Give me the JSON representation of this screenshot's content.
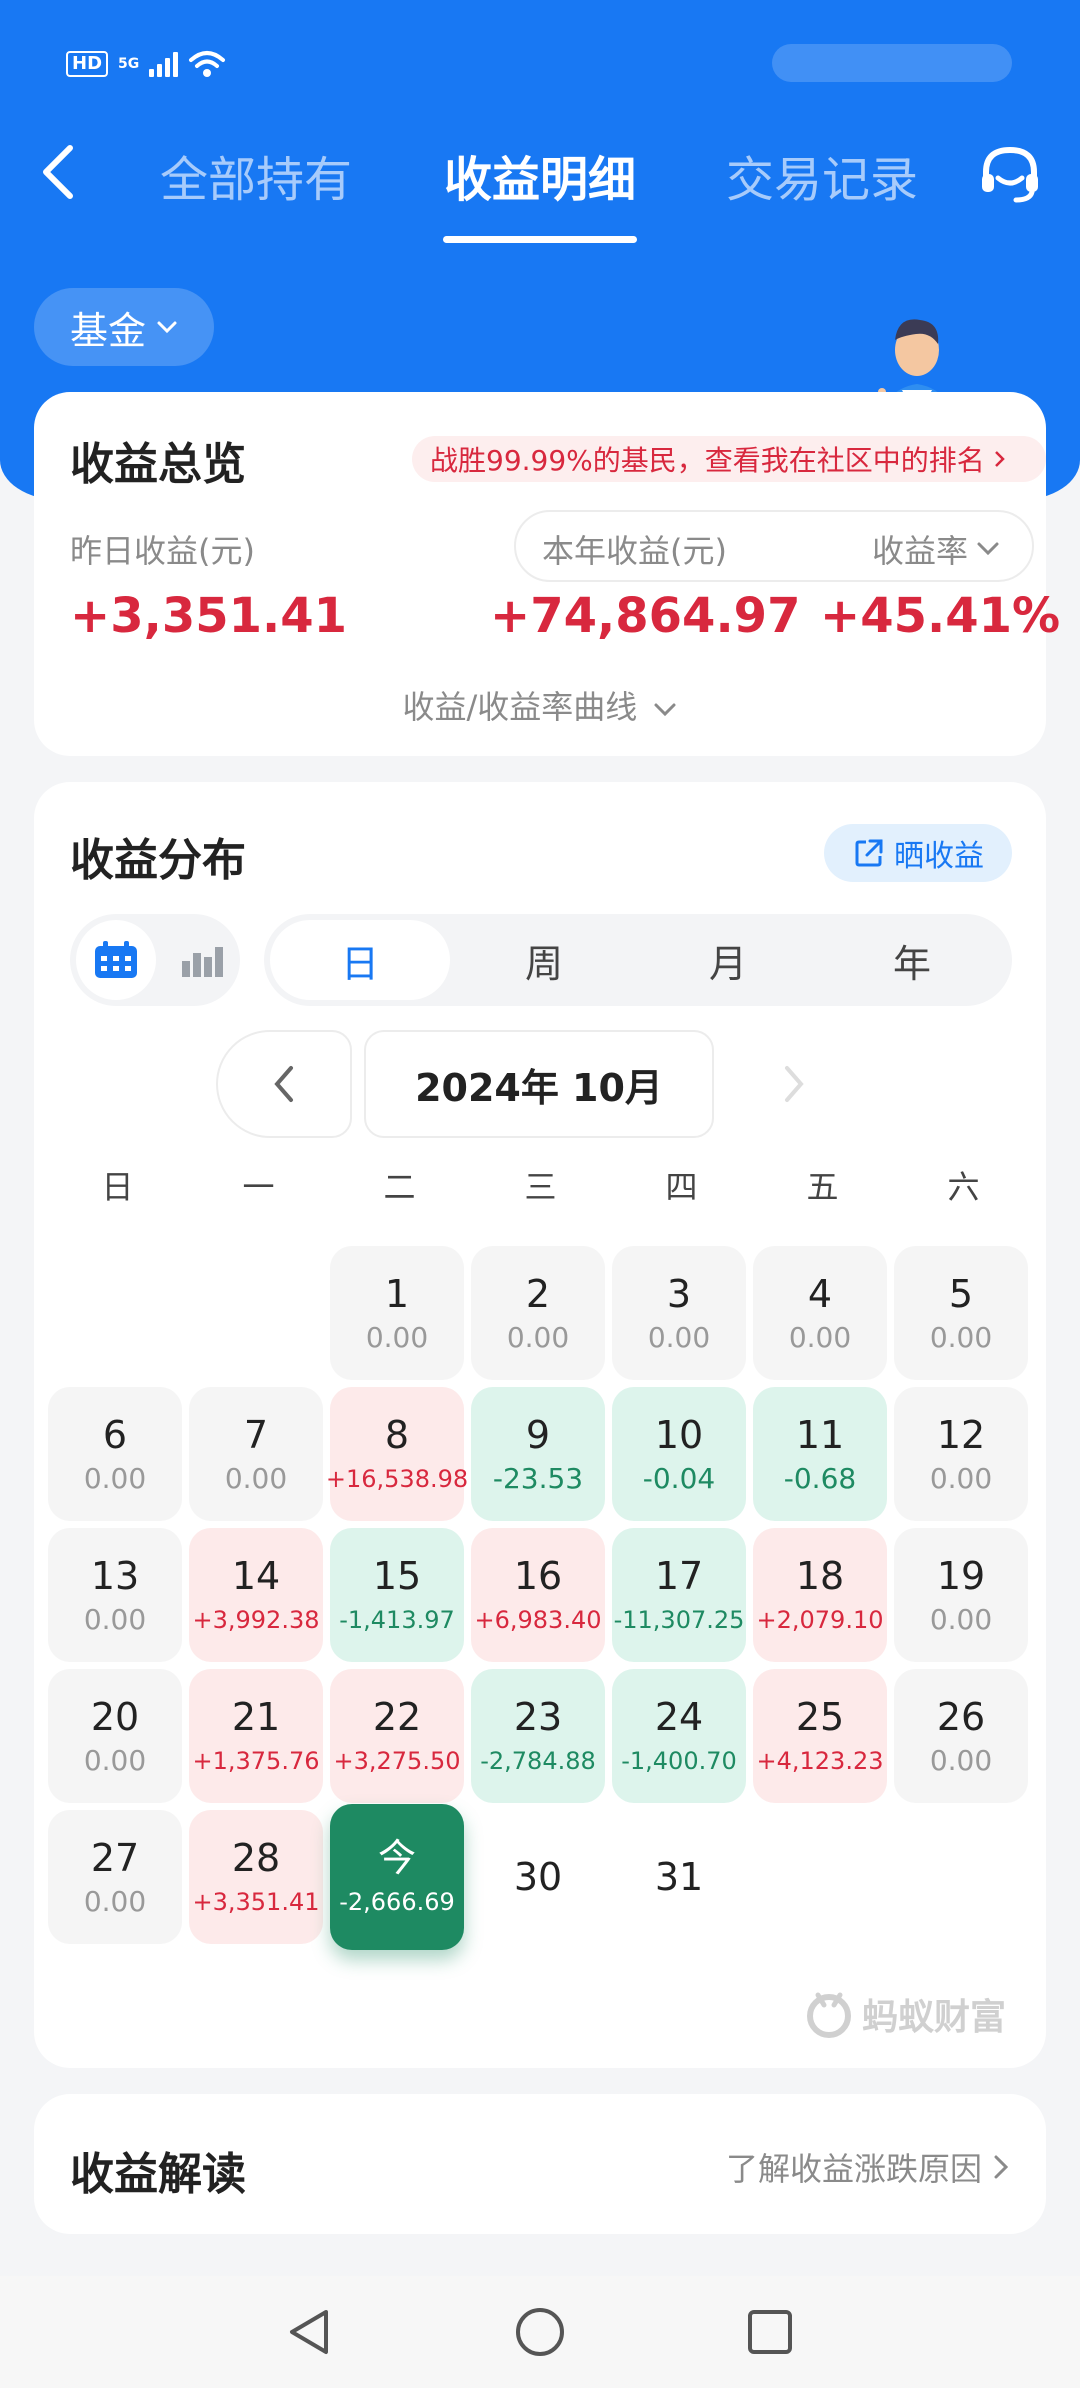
{
  "status_bar": {
    "hd": "HD",
    "network": "5G"
  },
  "nav": {
    "tabs": [
      {
        "label": "全部持有"
      },
      {
        "label": "收益明细"
      },
      {
        "label": "交易记录"
      }
    ]
  },
  "filter": {
    "label": "基金"
  },
  "overview": {
    "title": "收益总览",
    "rank_banner": "战胜99.99%的基民，查看我在社区中的排名",
    "yesterday_label": "昨日收益(元)",
    "yesterday_value": "+3,351.41",
    "year_label": "本年收益(元)",
    "year_value": "+74,864.97",
    "rate_label": "收益率",
    "rate_value": "+45.41%",
    "curve_toggle": "收益/收益率曲线"
  },
  "distribution": {
    "title": "收益分布",
    "share_label": "晒收益",
    "periods": [
      "日",
      "周",
      "月",
      "年"
    ],
    "month": "2024年 10月",
    "weekdays": [
      "日",
      "一",
      "二",
      "三",
      "四",
      "五",
      "六"
    ],
    "days": [
      {
        "d": "1",
        "v": "0.00",
        "t": "flat"
      },
      {
        "d": "2",
        "v": "0.00",
        "t": "flat"
      },
      {
        "d": "3",
        "v": "0.00",
        "t": "flat"
      },
      {
        "d": "4",
        "v": "0.00",
        "t": "flat"
      },
      {
        "d": "5",
        "v": "0.00",
        "t": "flat"
      },
      {
        "d": "6",
        "v": "0.00",
        "t": "flat"
      },
      {
        "d": "7",
        "v": "0.00",
        "t": "flat"
      },
      {
        "d": "8",
        "v": "+16,538.98",
        "t": "up"
      },
      {
        "d": "9",
        "v": "-23.53",
        "t": "down"
      },
      {
        "d": "10",
        "v": "-0.04",
        "t": "down"
      },
      {
        "d": "11",
        "v": "-0.68",
        "t": "down"
      },
      {
        "d": "12",
        "v": "0.00",
        "t": "flat"
      },
      {
        "d": "13",
        "v": "0.00",
        "t": "flat"
      },
      {
        "d": "14",
        "v": "+3,992.38",
        "t": "up"
      },
      {
        "d": "15",
        "v": "-1,413.97",
        "t": "down"
      },
      {
        "d": "16",
        "v": "+6,983.40",
        "t": "up"
      },
      {
        "d": "17",
        "v": "-11,307.25",
        "t": "down"
      },
      {
        "d": "18",
        "v": "+2,079.10",
        "t": "up"
      },
      {
        "d": "19",
        "v": "0.00",
        "t": "flat"
      },
      {
        "d": "20",
        "v": "0.00",
        "t": "flat"
      },
      {
        "d": "21",
        "v": "+1,375.76",
        "t": "up"
      },
      {
        "d": "22",
        "v": "+3,275.50",
        "t": "up"
      },
      {
        "d": "23",
        "v": "-2,784.88",
        "t": "down"
      },
      {
        "d": "24",
        "v": "-1,400.70",
        "t": "down"
      },
      {
        "d": "25",
        "v": "+4,123.23",
        "t": "up"
      },
      {
        "d": "26",
        "v": "0.00",
        "t": "flat"
      },
      {
        "d": "27",
        "v": "0.00",
        "t": "flat"
      },
      {
        "d": "28",
        "v": "+3,351.41",
        "t": "up"
      },
      {
        "d": "今",
        "v": "-2,666.69",
        "t": "today"
      },
      {
        "d": "30",
        "v": "",
        "t": "blank"
      },
      {
        "d": "31",
        "v": "",
        "t": "blank"
      }
    ],
    "watermark": "蚂蚁财富"
  },
  "interpretation": {
    "title": "收益解读",
    "link": "了解收益涨跌原因"
  },
  "colors": {
    "primary": "#1878f3",
    "gain": "#d8283e",
    "loss": "#1e8a62"
  }
}
